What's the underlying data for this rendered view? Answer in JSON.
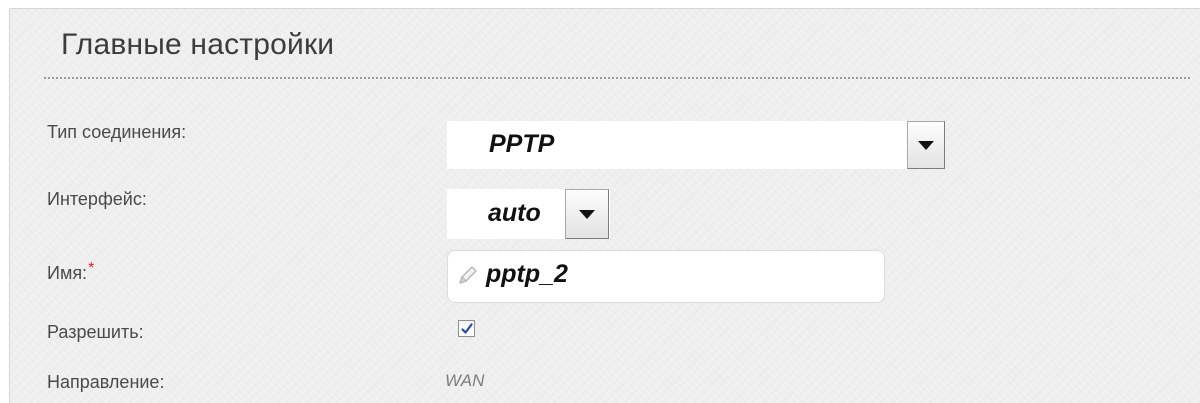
{
  "section": {
    "title": "Главные настройки"
  },
  "fields": {
    "connection_type": {
      "label": "Тип соединения:",
      "value": "PPTP"
    },
    "interface": {
      "label": "Интерфейс:",
      "value": "auto"
    },
    "name": {
      "label": "Имя:",
      "required_mark": "*",
      "value": "pptp_2"
    },
    "enable": {
      "label": "Разрешить:",
      "checked": true
    },
    "direction": {
      "label": "Направление:",
      "value": "WAN"
    }
  },
  "colors": {
    "panel_background": "#f1f1f1",
    "label_text": "#4a4a4a",
    "required_star": "#e02020",
    "checkmark": "#2a4aa0",
    "static_value": "#7c7c7c"
  },
  "icons": {
    "dropdown": "chevron-down-icon",
    "input_prefix": "pencil-icon",
    "checkbox_mark": "checkmark-icon"
  }
}
